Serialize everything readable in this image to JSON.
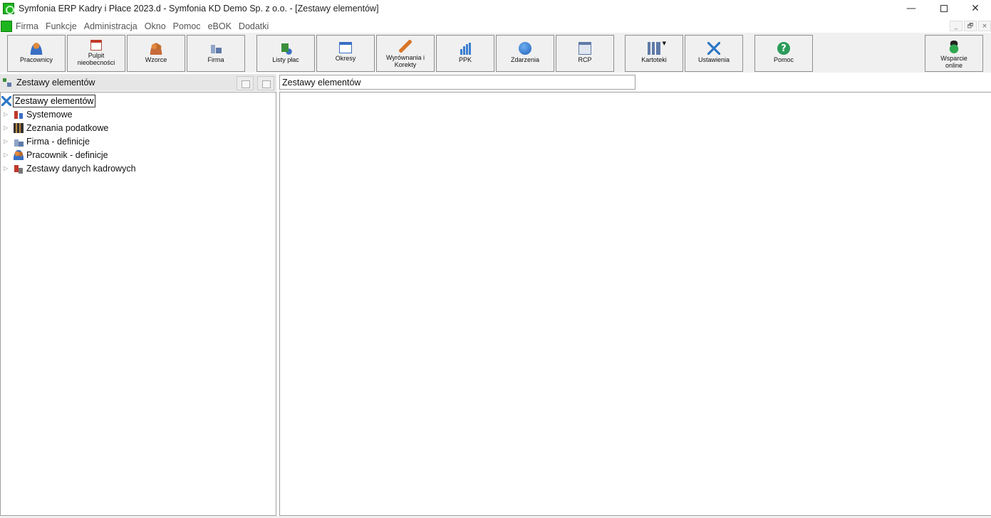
{
  "window": {
    "title": "Symfonia ERP Kadry i Płace 2023.d - Symfonia KD Demo Sp. z o.o. - [Zestawy elementów]",
    "minimize": "—",
    "close": "✕"
  },
  "menu": {
    "items": [
      "Firma",
      "Funkcje",
      "Administracja",
      "Okno",
      "Pomoc",
      "eBOK",
      "Dodatki"
    ],
    "mdi": [
      "_",
      "🗗",
      "×"
    ]
  },
  "toolbar": {
    "buttons": [
      {
        "label": "Pracownicy",
        "icon": "person-icon"
      },
      {
        "label": "Pulpit nieobecności",
        "icon": "calendar-icon"
      },
      {
        "label": "Wzorce",
        "icon": "group-icon"
      },
      {
        "label": "Firma",
        "icon": "building-icon"
      },
      {
        "label": "Listy płac",
        "icon": "payroll-list-icon"
      },
      {
        "label": "Okresy",
        "icon": "window-icon"
      },
      {
        "label": "Wyrównania i Korekty",
        "icon": "arrow-icon"
      },
      {
        "label": "PPK",
        "icon": "bar-chart-icon"
      },
      {
        "label": "Zdarzenia",
        "icon": "globe-icon"
      },
      {
        "label": "RCP",
        "icon": "rcp-icon"
      },
      {
        "label": "Kartoteki",
        "icon": "books-icon"
      },
      {
        "label": "Ustawienia",
        "icon": "tools-icon"
      },
      {
        "label": "Pomoc",
        "icon": "help-icon"
      },
      {
        "label": "Wsparcie online",
        "icon": "support-icon"
      }
    ],
    "help_glyph": "?"
  },
  "left_panel": {
    "header": "Zestawy elementów",
    "tree": {
      "root": "Zestawy elementów",
      "items": [
        "Systemowe",
        "Zeznania podatkowe",
        "Firma - definicje",
        "Pracownik - definicje",
        "Zestawy danych kadrowych"
      ]
    }
  },
  "right_panel": {
    "title": "Zestawy elementów"
  },
  "colors": {
    "app_green": "#1db51d",
    "toolbar_bg": "#f0f0f0",
    "border": "#8f8f8f"
  }
}
